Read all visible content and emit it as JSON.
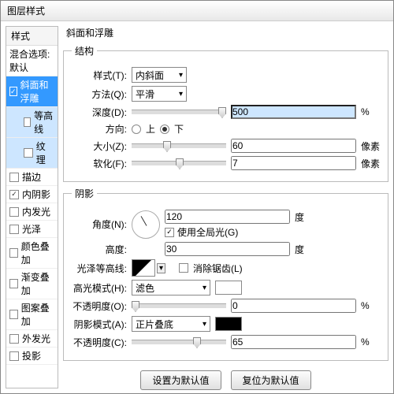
{
  "title": "图层样式",
  "styles_header": "样式",
  "styles": [
    {
      "label": "混合选项:默认",
      "checked": false,
      "indent": false,
      "sel": false,
      "check_hidden": true
    },
    {
      "label": "斜面和浮雕",
      "checked": true,
      "indent": false,
      "sel": true
    },
    {
      "label": "等高线",
      "checked": false,
      "indent": true,
      "sel2": true
    },
    {
      "label": "纹理",
      "checked": false,
      "indent": true,
      "sel2": true
    },
    {
      "label": "描边",
      "checked": false
    },
    {
      "label": "内阴影",
      "checked": true
    },
    {
      "label": "内发光",
      "checked": false
    },
    {
      "label": "光泽",
      "checked": false
    },
    {
      "label": "颜色叠加",
      "checked": false
    },
    {
      "label": "渐变叠加",
      "checked": false
    },
    {
      "label": "图案叠加",
      "checked": false
    },
    {
      "label": "外发光",
      "checked": false
    },
    {
      "label": "投影",
      "checked": false
    }
  ],
  "main_title": "斜面和浮雕",
  "structure": {
    "legend": "结构",
    "style_label": "样式(T):",
    "style_value": "内斜面",
    "method_label": "方法(Q):",
    "method_value": "平滑",
    "depth_label": "深度(D):",
    "depth_value": "500",
    "depth_unit": "%",
    "direction_label": "方向:",
    "up": "上",
    "down": "下",
    "size_label": "大小(Z):",
    "size_value": "60",
    "size_unit": "像素",
    "soften_label": "软化(F):",
    "soften_value": "7",
    "soften_unit": "像素"
  },
  "shading": {
    "legend": "阴影",
    "angle_label": "角度(N):",
    "angle_value": "120",
    "angle_unit": "度",
    "global_label": "使用全局光(G)",
    "altitude_label": "高度:",
    "altitude_value": "30",
    "altitude_unit": "度",
    "contour_label": "光泽等高线:",
    "antialias_label": "消除锯齿(L)",
    "highlight_mode_label": "高光模式(H):",
    "highlight_mode_value": "滤色",
    "highlight_opacity_label": "不透明度(O):",
    "highlight_opacity_value": "0",
    "opacity_unit": "%",
    "shadow_mode_label": "阴影模式(A):",
    "shadow_mode_value": "正片叠底",
    "shadow_opacity_label": "不透明度(C):",
    "shadow_opacity_value": "65"
  },
  "buttons": {
    "default": "设置为默认值",
    "reset": "复位为默认值"
  }
}
